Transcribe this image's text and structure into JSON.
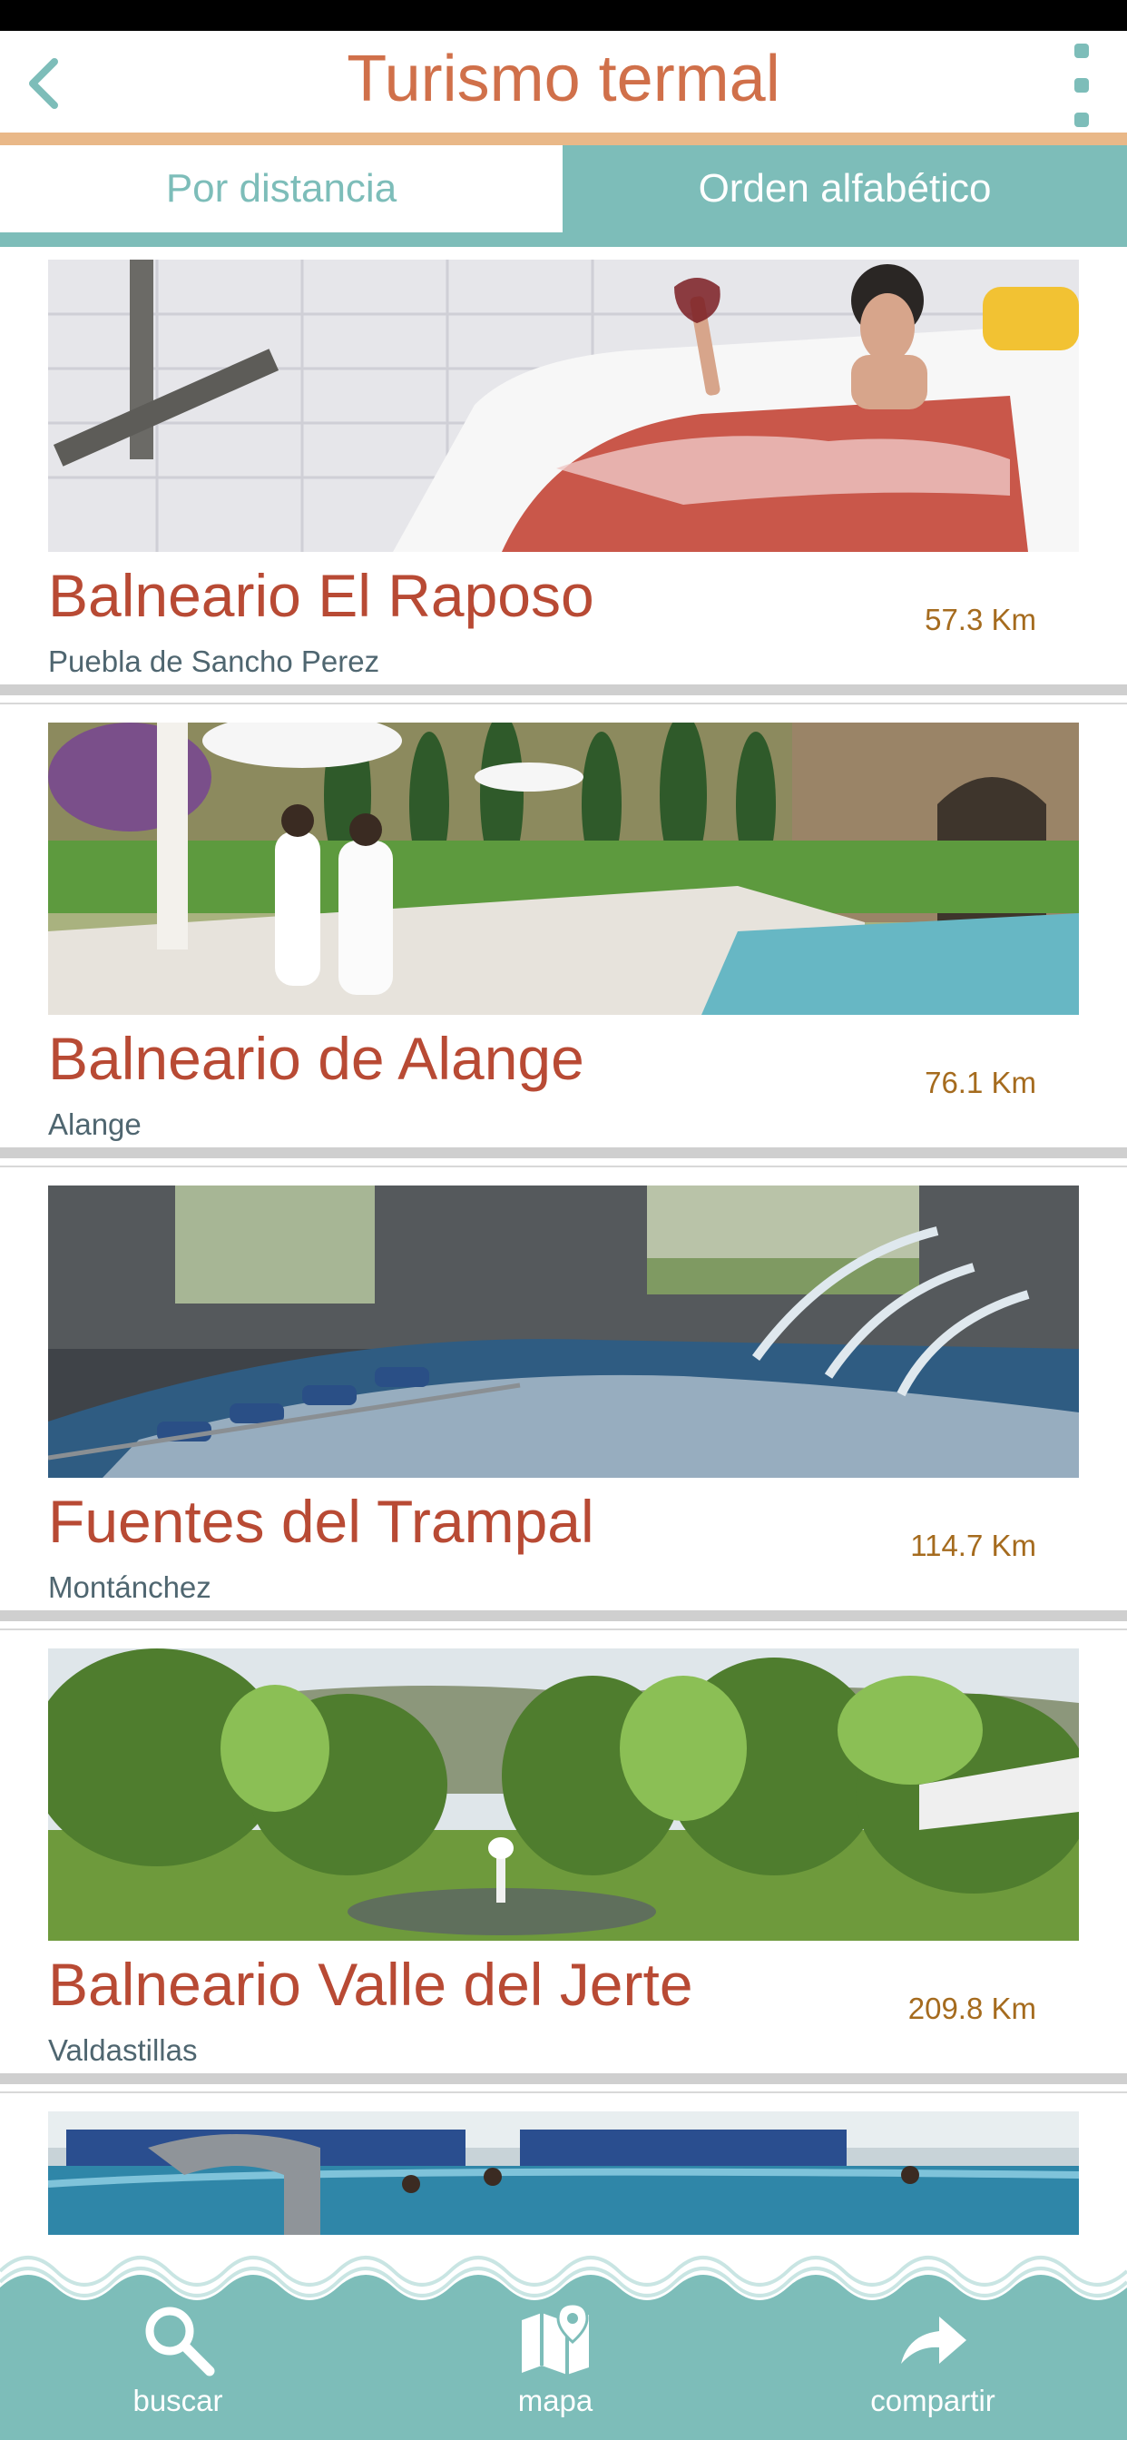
{
  "header": {
    "title": "Turismo termal",
    "back_icon": "chevron-left-icon",
    "menu_icon": "more-vertical-icon"
  },
  "tabs": {
    "distance": "Por distancia",
    "alphabetical": "Orden alfabético",
    "active": "alphabetical"
  },
  "spas": [
    {
      "name": "Balneario El Raposo",
      "town": "Puebla de Sancho Perez",
      "distance": "57.3 Km",
      "photo": "woman in bath with red wine"
    },
    {
      "name": "Balneario de Alange",
      "town": "Alange",
      "distance": "76.1 Km",
      "photo": "couple in robes by outdoor pool"
    },
    {
      "name": "Fuentes del Trampal",
      "town": "Montánchez",
      "distance": "114.7 Km",
      "photo": "indoor hydrotherapy pool with fountains"
    },
    {
      "name": "Balneario Valle del Jerte",
      "town": "Valdastillas",
      "distance": "209.8 Km",
      "photo": "green garden with pond and fountain"
    },
    {
      "name": "",
      "town": "",
      "distance": "",
      "photo": "indoor thermal pool with bathers"
    }
  ],
  "bottom_nav": {
    "search_label": "buscar",
    "map_label": "mapa",
    "share_label": "compartir"
  },
  "colors": {
    "teal": "#7dbdb9",
    "title_orange": "#d0704a",
    "card_title_red": "#b84a34",
    "distance_brown": "#a56b1e",
    "header_line": "#e9b888"
  }
}
